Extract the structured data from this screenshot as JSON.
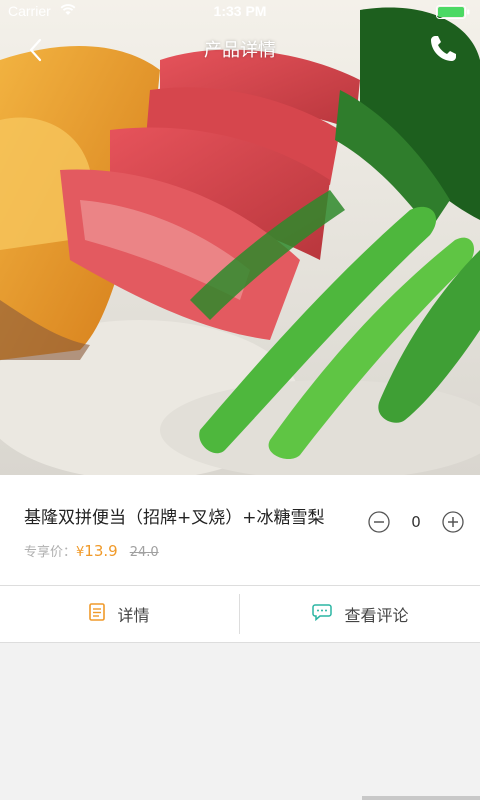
{
  "status_bar": {
    "carrier": "Carrier",
    "time": "1:33 PM"
  },
  "nav": {
    "title": "产品详情",
    "back_icon": "chevron-left-icon",
    "phone_icon": "phone-icon"
  },
  "product": {
    "name": "基隆双拼便当（招牌+叉烧）+冰糖雪梨",
    "price_label": "专享价：",
    "currency": "¥",
    "price": "13.9",
    "original_price": "24.0",
    "quantity": "0"
  },
  "tabs": [
    {
      "label": "详情",
      "icon": "document-icon"
    },
    {
      "label": "查看评论",
      "icon": "comment-bubble-icon"
    }
  ],
  "colors": {
    "accent": "#f09a2a",
    "comment_icon": "#2bb5a3"
  }
}
